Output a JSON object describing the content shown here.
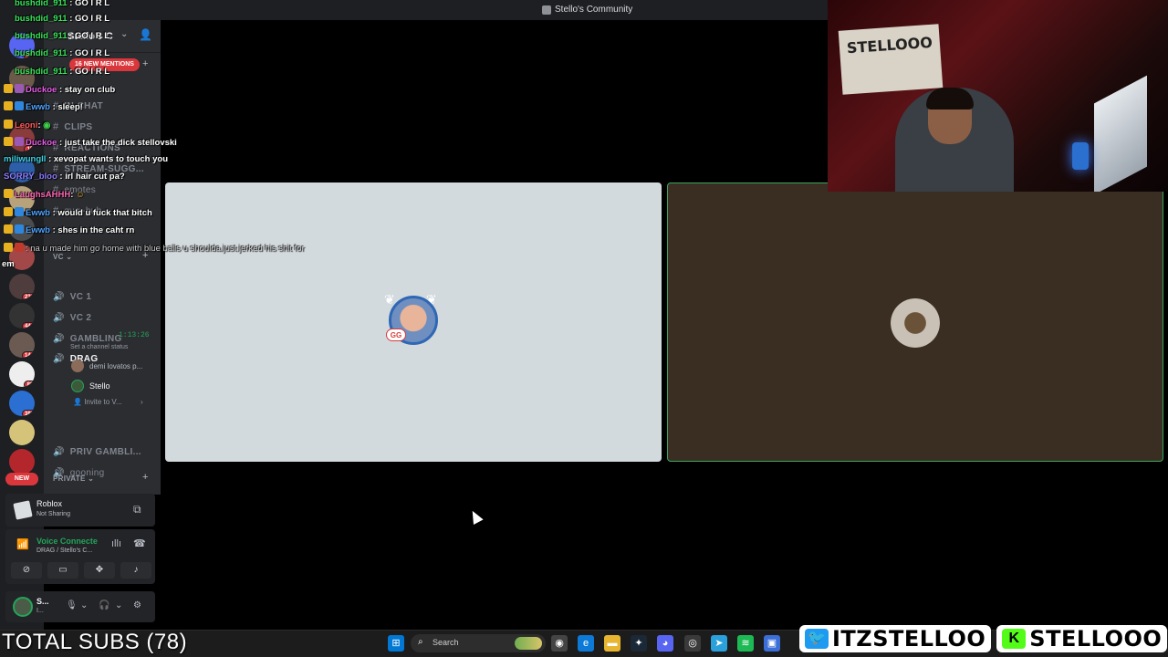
{
  "window": {
    "title": "Stello's Community"
  },
  "server": {
    "name": "Stello's C",
    "mentions_label": "16 NEW MENTIONS",
    "new_label": "NEW"
  },
  "rail_badges": [
    "48",
    "15",
    "231",
    "444",
    "144",
    "80",
    "383"
  ],
  "channels": {
    "text": [
      "IN-CHAT",
      "CLIPS",
      "REACTIONS",
      "STREAM-SUGG...",
      "emotes",
      "gym-hub"
    ],
    "voice_category": "VC",
    "voice": [
      "VC 1",
      "VC 2",
      "GAMBLING",
      "DRAG",
      "PRIV GAMBLI...",
      "gooning"
    ],
    "drag_timer": "1:13:26",
    "channel_status_placeholder": "Set a channel status",
    "members": [
      "demi lovatos p...",
      "Stello"
    ],
    "invite_label": "Invite to V...",
    "private_category": "PRIVATE"
  },
  "activity": {
    "game": "Roblox",
    "status": "Not Sharing"
  },
  "voice_panel": {
    "title": "Voice Connecte",
    "subtitle": "DRAG / Stello's C..."
  },
  "user_panel": {
    "name": "S...",
    "status": "I..."
  },
  "chat": [
    {
      "user": "bushdid_911",
      "text": ": GO I R L",
      "color": "#39e35a"
    },
    {
      "user": "bushdid_911",
      "text": ": GO I R L",
      "color": "#39e35a"
    },
    {
      "user": "bushdid_911",
      "text": ": GO I R L",
      "color": "#39e35a"
    },
    {
      "user": "bushdid_911",
      "text": ": GO I R L",
      "color": "#39e35a"
    },
    {
      "user": "bushdid_911",
      "text": ": GO I R L",
      "color": "#39e35a"
    },
    {
      "user": "Duckoe",
      "text": ": stay on club",
      "color": "#e65ce8"
    },
    {
      "user": "Ewwb",
      "text": ": sleep!",
      "color": "#4fa3ff"
    },
    {
      "user": "Leoni",
      "text": ":",
      "color": "#ff5b5b"
    },
    {
      "user": "Duckoe",
      "text": ": just take the dick stellovski",
      "color": "#e65ce8"
    },
    {
      "user": "miliwungII",
      "text": ": xevopat wants to touch you",
      "color": "#3fd0e0"
    },
    {
      "user": "SORRY_bloo",
      "text": ": irl hair cut pa?",
      "color": "#8b7bff"
    },
    {
      "user": "LaughsAHHH",
      "text": ":",
      "color": "#ff66b3"
    },
    {
      "user": "Ewwb",
      "text": ": would u fuck that bitch",
      "color": "#4fa3ff"
    },
    {
      "user": "Ewwb",
      "text": ": shes in the caht rn",
      "color": "#4fa3ff"
    },
    {
      "user": "",
      "text": ": na u made him go home with blue balls u shoulda just jerked his shit for",
      "color": "#ff5b5b"
    }
  ],
  "chat_fragment": "em",
  "overlay": {
    "total_subs": "TOTAL SUBS (78)",
    "twitter_handle": "ITZSTELLOO",
    "kick_handle": "STELLOOO",
    "poster_text": "STELLOOO"
  },
  "taskbar": {
    "search_label": "Search"
  }
}
